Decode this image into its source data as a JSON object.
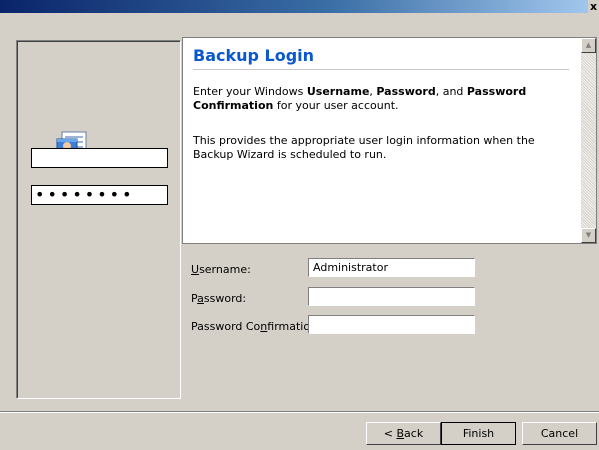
{
  "window": {
    "close_glyph": "x"
  },
  "sidebar": {
    "username_value": "",
    "password_mask": "••••••••"
  },
  "info": {
    "title": "Backup Login",
    "para1_prefix": "Enter your Windows ",
    "para1_b1": "Username",
    "para1_sep1": ", ",
    "para1_b2": "Password",
    "para1_sep2": ", and ",
    "para1_b3": "Password Confirmation",
    "para1_suffix": " for your user account.",
    "para2": "This provides the appropriate user login information when the Backup Wizard is scheduled to run."
  },
  "form": {
    "username_label_u": "U",
    "username_label_rest": "sername:",
    "username_value": "Administrator",
    "password_label_a": "P",
    "password_label_u": "a",
    "password_label_rest": "ssword:",
    "password_value": "",
    "confirm_label_pre": "Password Co",
    "confirm_label_u": "n",
    "confirm_label_rest": "firmation:",
    "confirm_value": ""
  },
  "buttons": {
    "back_pre": "< ",
    "back_u": "B",
    "back_rest": "ack",
    "finish": "Finish",
    "cancel": "Cancel"
  },
  "icons": [
    "user-login-icon",
    "close-icon",
    "scroll-up-icon",
    "scroll-down-icon"
  ]
}
